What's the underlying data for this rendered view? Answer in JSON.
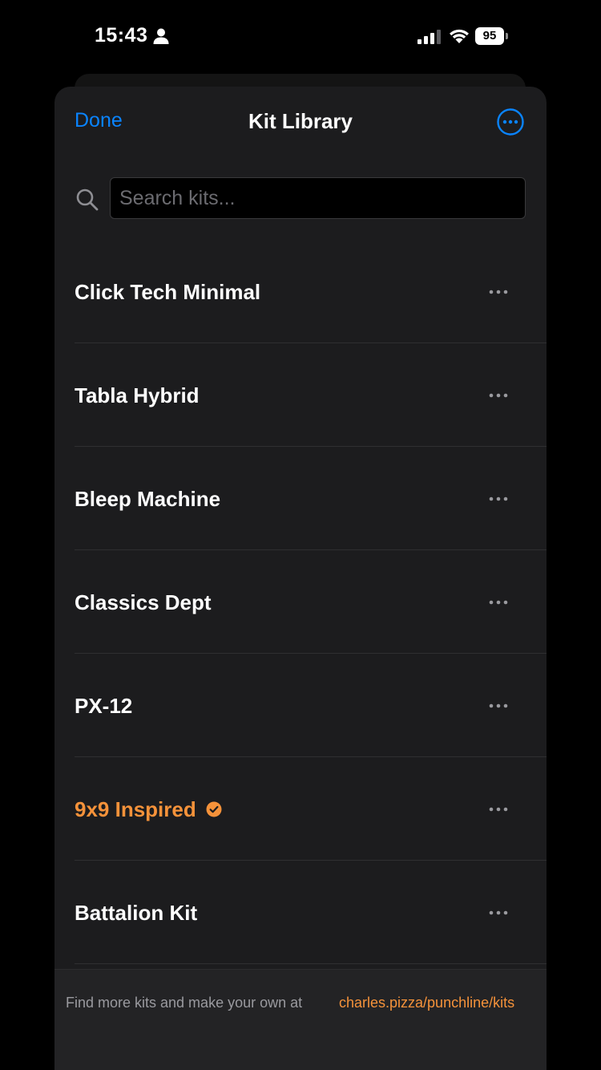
{
  "status_bar": {
    "time": "15:43",
    "battery": "95"
  },
  "nav": {
    "done_label": "Done",
    "title": "Kit Library"
  },
  "search": {
    "placeholder": "Search kits..."
  },
  "kits": [
    {
      "name": "Click Tech Minimal",
      "selected": false
    },
    {
      "name": "Tabla Hybrid",
      "selected": false
    },
    {
      "name": "Bleep Machine",
      "selected": false
    },
    {
      "name": "Classics Dept",
      "selected": false
    },
    {
      "name": "PX-12",
      "selected": false
    },
    {
      "name": "9x9 Inspired",
      "selected": true
    },
    {
      "name": "Battalion Kit",
      "selected": false
    }
  ],
  "footer": {
    "text": "Find more kits and make your own at",
    "link": "charles.pizza/punchline/kits"
  },
  "colors": {
    "accent_blue": "#0a84ff",
    "accent_orange": "#f5923a",
    "sheet_background": "#1c1c1e"
  }
}
